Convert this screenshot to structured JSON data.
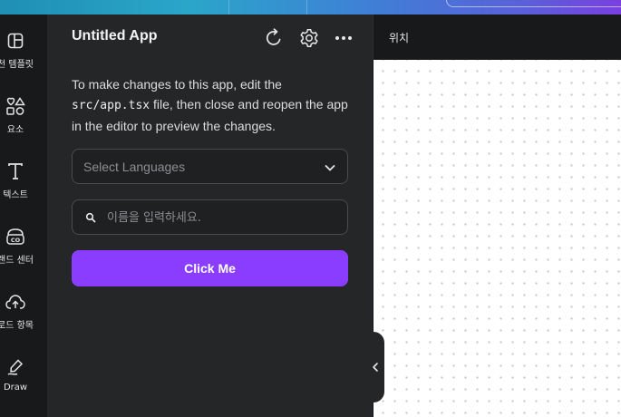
{
  "top_bar": {},
  "rail": {
    "items": [
      {
        "label": "천 템플릿",
        "icon": "layout-icon"
      },
      {
        "label": "요소",
        "icon": "elements-icon"
      },
      {
        "label": "텍스트",
        "icon": "text-icon"
      },
      {
        "label": "랜드 센터",
        "icon": "brand-icon"
      },
      {
        "label": "로드 항목",
        "icon": "upload-icon"
      },
      {
        "label": "Draw",
        "icon": "draw-icon"
      }
    ]
  },
  "panel": {
    "title": "Untitled App",
    "description_before": "To make changes to this app, edit the ",
    "description_code": "src/app.tsx",
    "description_after": " file, then close and reopen the app in the editor to preview the changes.",
    "select_placeholder": "Select Languages",
    "search_placeholder": "이름을 입력하세요.",
    "button_label": "Click Me",
    "header_icons": [
      "refresh-icon",
      "settings-icon",
      "more-icon"
    ]
  },
  "canvas": {
    "header_label": "위치"
  },
  "colors": {
    "accent": "#8b3dff",
    "panel_bg": "#252627",
    "rail_bg": "#18191b",
    "canvas_bg": "#ffffff"
  }
}
